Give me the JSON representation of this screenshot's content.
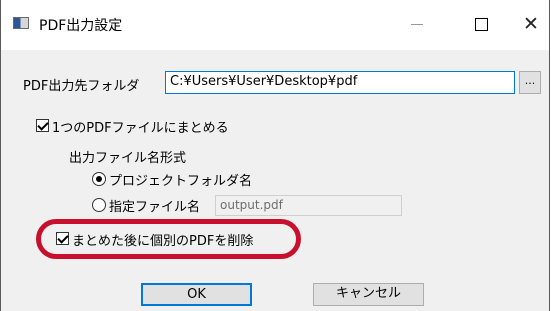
{
  "window": {
    "title": "PDF出力設定",
    "minimize_label": "—",
    "maximize_label": "☐",
    "close_label": "✕"
  },
  "output_folder": {
    "label": "PDF出力先フォルダ",
    "value": "C:¥Users¥User¥Desktop¥pdf",
    "browse_label": "..."
  },
  "merge_option": {
    "label": "1つのPDFファイルにまとめる",
    "checked": true
  },
  "filename_format": {
    "heading": "出力ファイル名形式",
    "options": [
      {
        "label": "プロジェクトフォルダ名",
        "selected": true
      },
      {
        "label": "指定ファイル名",
        "selected": false
      }
    ],
    "custom_name_value": "output.pdf"
  },
  "delete_option": {
    "label": "まとめた後に個別のPDFを削除",
    "checked": true,
    "highlight_color": "#c8102e"
  },
  "buttons": {
    "ok_label": "OK",
    "cancel_label": "キャンセル"
  },
  "colors": {
    "focus_border": "#0078d7",
    "dialog_background": "#f0f0f0"
  }
}
